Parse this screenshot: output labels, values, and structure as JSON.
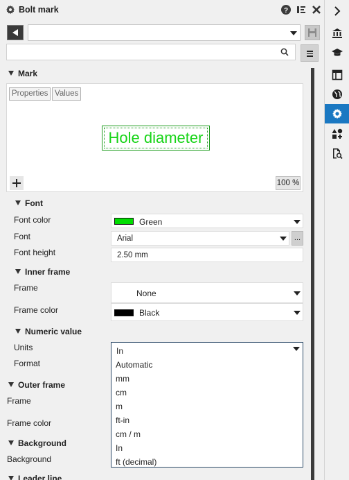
{
  "window": {
    "title": "Bolt mark"
  },
  "toolbar": {
    "preset_value": "",
    "search_placeholder": ""
  },
  "mark": {
    "section_label": "Mark",
    "tab_properties": "Properties",
    "tab_values": "Values",
    "preview_text": "Hole diameter",
    "preview_color": "#17d417",
    "zoom": "100 %"
  },
  "font": {
    "section_label": "Font",
    "color_label": "Font color",
    "color_value": "Green",
    "color_swatch": "#00dd00",
    "font_label": "Font",
    "font_value": "Arial",
    "height_label": "Font height",
    "height_value": "2.50 mm",
    "more_button": "..."
  },
  "inner_frame": {
    "section_label": "Inner frame",
    "frame_label": "Frame",
    "frame_value": "None",
    "color_label": "Frame color",
    "color_value": "Black",
    "color_swatch": "#000000"
  },
  "numeric_value": {
    "section_label": "Numeric value",
    "units_label": "Units",
    "units_value": "In",
    "format_label": "Format",
    "units_options": [
      "Automatic",
      "mm",
      "cm",
      "m",
      "ft-in",
      "cm / m",
      "In",
      "ft (decimal)"
    ]
  },
  "outer_frame": {
    "section_label": "Outer frame",
    "frame_label": "Frame",
    "color_label": "Frame color"
  },
  "background": {
    "section_label": "Background",
    "background_label": "Background"
  },
  "leader_line": {
    "section_label": "Leader line"
  },
  "sidebar": {
    "icons": [
      "chevron-right-icon",
      "bank-icon",
      "graduation-cap-icon",
      "layout-icon",
      "globe-icon",
      "settings-icon",
      "shapes-add-icon",
      "file-search-icon"
    ],
    "active_color": "#1a78c2"
  }
}
